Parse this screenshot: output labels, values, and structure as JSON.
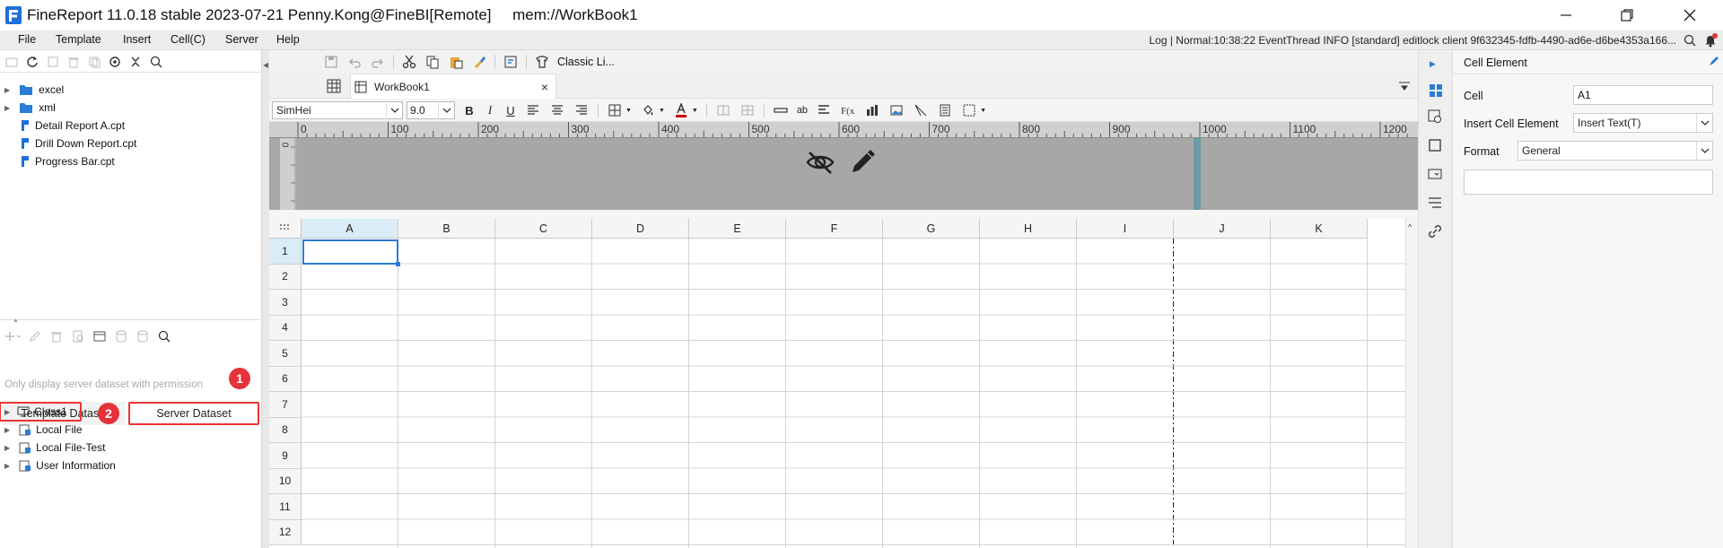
{
  "window": {
    "title": "FineReport 11.0.18 stable 2023-07-21 Penny.Kong@FineBI[Remote]     mem://WorkBook1"
  },
  "menu": {
    "items": [
      "File",
      "Template",
      "Insert",
      "Cell(C)",
      "Server",
      "Help"
    ],
    "log": "Log | Normal:10:38:22 EventThread INFO [standard] editlock client 9f632345-fdfb-4490-ad6e-d6be4353a166..."
  },
  "file_tree": {
    "items": [
      "excel",
      "xml",
      "Detail Report A.cpt",
      "Drill Down Report.cpt",
      "Progress Bar.cpt"
    ]
  },
  "dataset": {
    "tab_template": "Template Dataset",
    "tab_server": "Server Dataset",
    "hint": "Only display server dataset with permission",
    "items": [
      "Class1",
      "Local File",
      "Local File-Test",
      "User Information"
    ],
    "badge1": "1",
    "badge2": "2"
  },
  "toolbar": {
    "style_label": "Classic Li...",
    "font_name": "SimHei",
    "font_size": "9.0",
    "bold": "B",
    "italic": "I",
    "underline": "U",
    "ab": "ab"
  },
  "tab": {
    "name": "WorkBook1",
    "close": "×"
  },
  "ruler": {
    "ticks": [
      "0",
      "100",
      "200",
      "300",
      "400",
      "500",
      "600",
      "700",
      "800",
      "900",
      "1000",
      "1100",
      "1200"
    ],
    "vzero": "0"
  },
  "sheet": {
    "columns": [
      "A",
      "B",
      "C",
      "D",
      "E",
      "F",
      "G",
      "H",
      "I",
      "J",
      "K"
    ],
    "rows": [
      "1",
      "2",
      "3",
      "4",
      "5",
      "6",
      "7",
      "8",
      "9",
      "10",
      "11",
      "12"
    ]
  },
  "cell_panel": {
    "title": "Cell Element",
    "cell_label": "Cell",
    "cell_value": "A1",
    "insert_label": "Insert Cell Element",
    "insert_value": "Insert Text(T)",
    "format_label": "Format",
    "format_value": "General"
  },
  "colors": {
    "accent": "#2b7cd3",
    "badge": "#e5323b",
    "ruler_bg": "#a7a7a7",
    "selected_col": "#d9ecf8"
  }
}
